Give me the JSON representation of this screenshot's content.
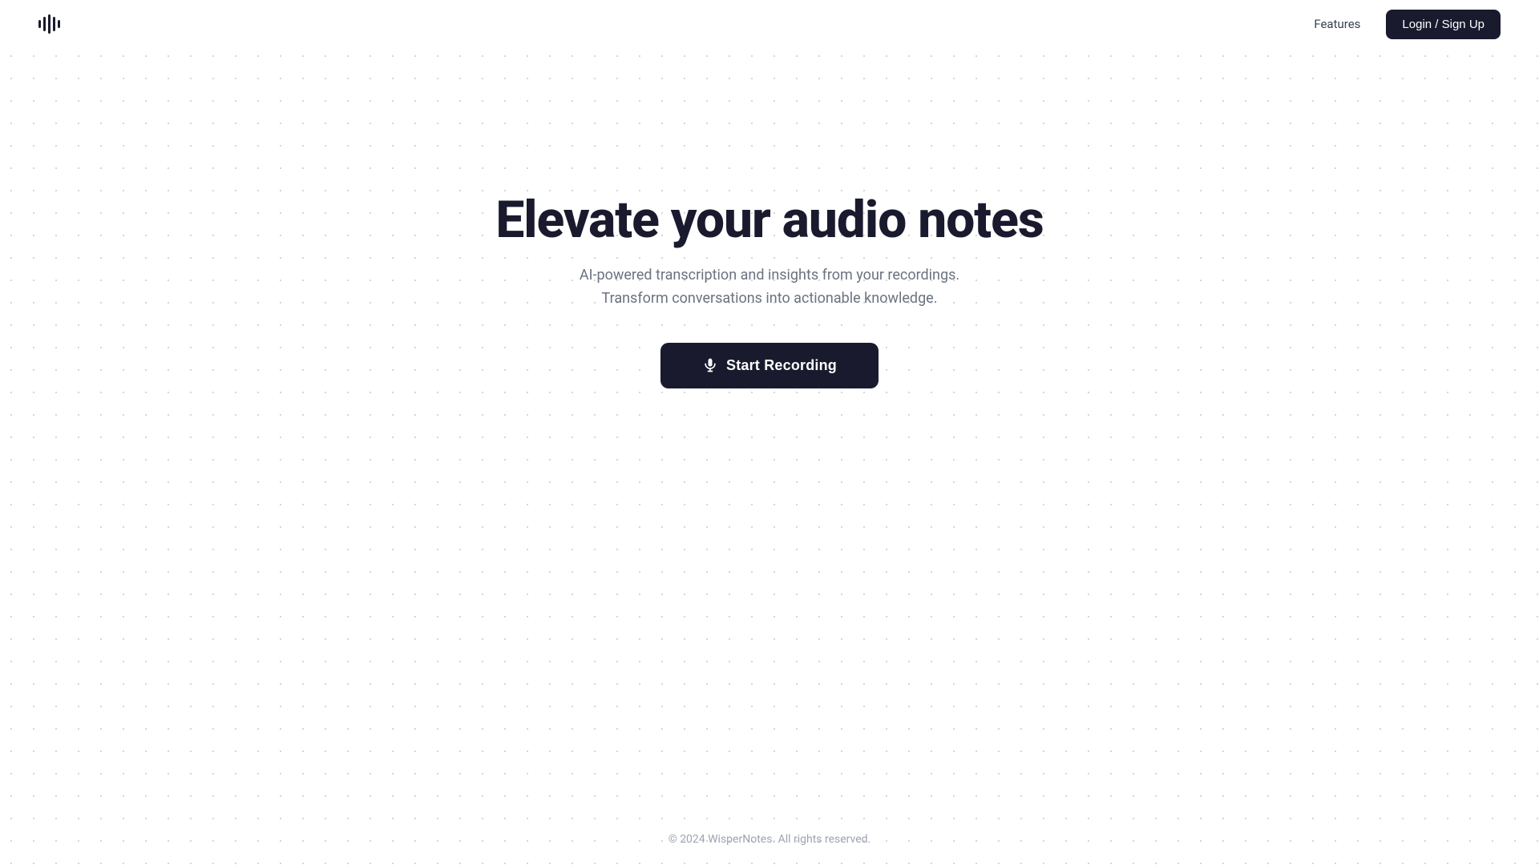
{
  "navbar": {
    "logo_icon": "audio-waveform-icon",
    "nav_link_label": "Features",
    "login_button_label": "Login / Sign Up"
  },
  "hero": {
    "title": "Elevate your audio notes",
    "subtitle_line1": "AI-powered transcription and insights from your recordings.",
    "subtitle_line2": "Transform conversations into actionable knowledge.",
    "cta_button_label": "Start Recording"
  },
  "footer": {
    "copyright": "© 2024 WisperNotes. All rights reserved."
  },
  "colors": {
    "dark": "#1a1a2e",
    "text_muted": "#6b7280",
    "dot_color": "#c8c8c8",
    "white": "#ffffff"
  }
}
